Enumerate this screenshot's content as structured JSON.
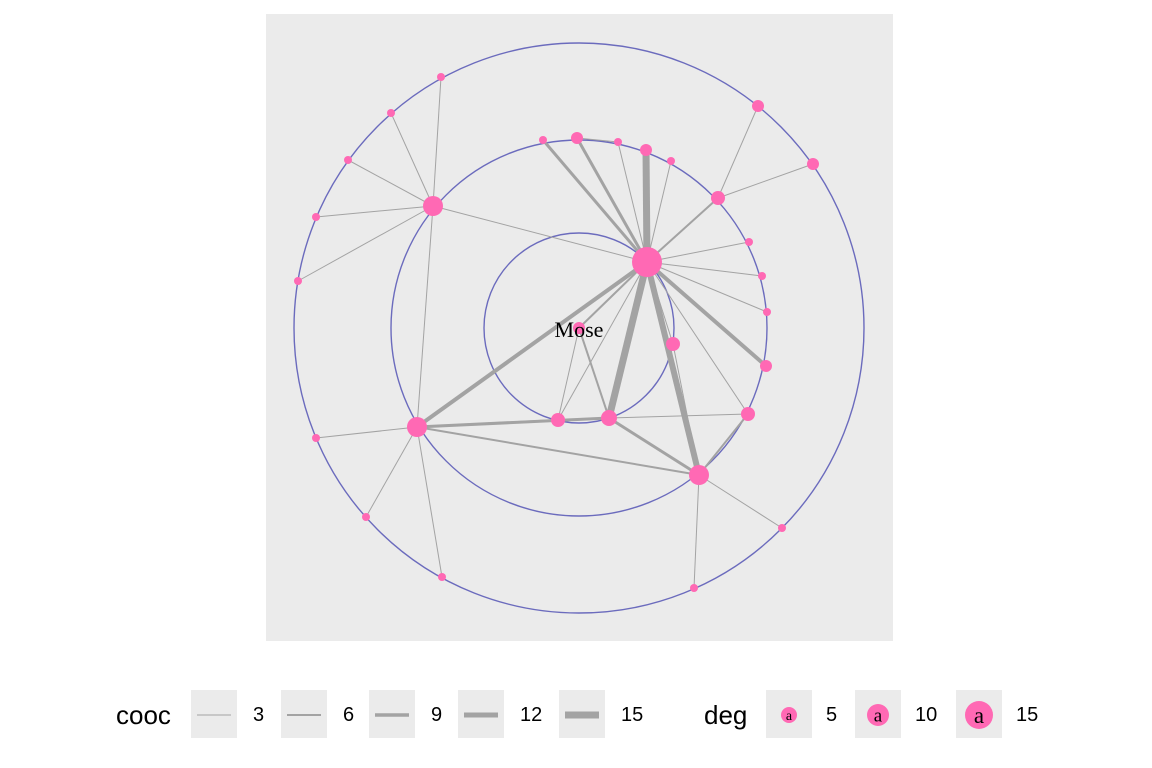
{
  "graph": {
    "center_label": "Mose",
    "colors": {
      "panel_bg": "#ebebeb",
      "ring": "#6b6bbd",
      "edge": "#a3a3a3",
      "node": "#ff69b4"
    }
  },
  "legend": {
    "cooc": {
      "title": "cooc",
      "items": [
        {
          "label": "3",
          "value": 3
        },
        {
          "label": "6",
          "value": 6
        },
        {
          "label": "9",
          "value": 9
        },
        {
          "label": "12",
          "value": 12
        },
        {
          "label": "15",
          "value": 15
        }
      ]
    },
    "deg": {
      "title": "deg",
      "glyph": "a",
      "items": [
        {
          "label": "5",
          "value": 5
        },
        {
          "label": "10",
          "value": 10
        },
        {
          "label": "15",
          "value": 15
        }
      ]
    }
  }
}
